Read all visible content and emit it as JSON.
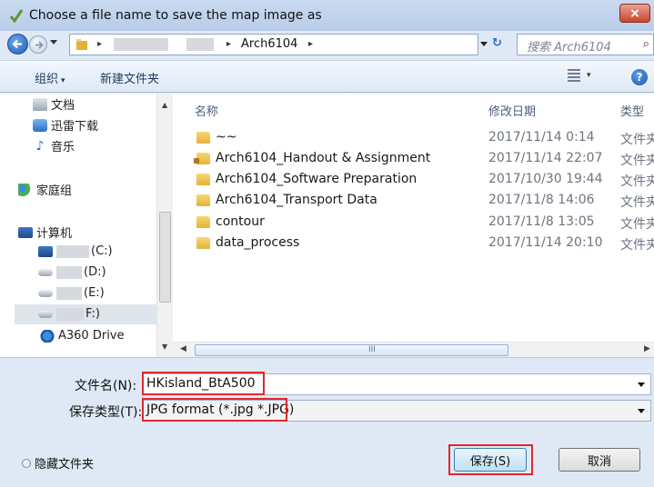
{
  "window": {
    "title": "Choose a file name to save the map image as",
    "close_label": "×"
  },
  "address_bar": {
    "current_folder": "Arch6104",
    "separator": "▸",
    "search_placeholder": "搜索 Arch6104",
    "refresh_icon": "↻",
    "search_icon": "⌕"
  },
  "toolbar": {
    "organize_label": "组织",
    "organize_arrow": "▾",
    "new_folder_label": "新建文件夹",
    "view_arrow": "▾",
    "help_label": "?"
  },
  "nav_pane": {
    "items": [
      {
        "label": "文档",
        "icon": "documents-icon"
      },
      {
        "label": "迅雷下载",
        "icon": "downloads-icon"
      },
      {
        "label": "音乐",
        "icon": "music-icon"
      },
      {
        "label": "家庭组",
        "icon": "homegroup-icon"
      },
      {
        "label": "计算机",
        "icon": "computer-icon"
      },
      {
        "label": "(C:)",
        "icon": "drive-icon"
      },
      {
        "label": "(D:)",
        "icon": "drive-icon"
      },
      {
        "label": "(E:)",
        "icon": "drive-icon"
      },
      {
        "label": "F:)",
        "icon": "drive-icon"
      },
      {
        "label": "A360 Drive",
        "icon": "cloud-drive-icon"
      }
    ],
    "music_glyph": "♪",
    "scroll_up": "▲",
    "scroll_down": "▼"
  },
  "file_list": {
    "columns": [
      "名称",
      "修改日期",
      "类型"
    ],
    "rows": [
      {
        "name": "~~",
        "date": "2017/11/14 0:14",
        "type": "文件夹"
      },
      {
        "name": "Arch6104_Handout & Assignment",
        "date": "2017/11/14 22:07",
        "type": "文件夹"
      },
      {
        "name": "Arch6104_Software Preparation",
        "date": "2017/10/30 19:44",
        "type": "文件夹"
      },
      {
        "name": "Arch6104_Transport Data",
        "date": "2017/11/8 14:06",
        "type": "文件夹"
      },
      {
        "name": "contour",
        "date": "2017/11/8 13:05",
        "type": "文件夹"
      },
      {
        "name": "data_process",
        "date": "2017/11/14 20:10",
        "type": "文件夹"
      }
    ],
    "hscroll_grip": "III",
    "hscroll_left": "◀",
    "hscroll_right": "▶"
  },
  "save_form": {
    "filename_label": "文件名(N):",
    "filename_value": "HKisland_BtA500",
    "filetype_label": "保存类型(T):",
    "filetype_value": "JPG format (*.jpg *.JPG)",
    "hide_folders_label": "隐藏文件夹",
    "save_button": "保存(S)",
    "cancel_button": "取消"
  },
  "colors": {
    "highlight_red": "#e0282f",
    "folder_yellow": "#e3b23c",
    "window_bg": "#dfe9f5"
  }
}
